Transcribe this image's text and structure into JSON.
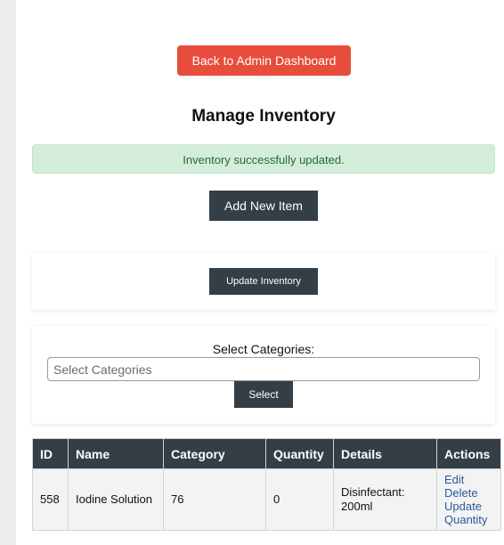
{
  "header": {
    "back_label": "Back to Admin Dashboard",
    "title": "Manage Inventory"
  },
  "alert": {
    "message": "Inventory successfully updated."
  },
  "toolbar": {
    "add_label": "Add New Item",
    "update_label": "Update Inventory"
  },
  "category_filter": {
    "label": "Select Categories:",
    "placeholder": "Select Categories",
    "button_label": "Select"
  },
  "table": {
    "headers": [
      "ID",
      "Name",
      "Category",
      "Quantity",
      "Details",
      "Actions"
    ],
    "rows": [
      {
        "id": "558",
        "name": "Iodine Solution",
        "category": "76",
        "quantity": "0",
        "details": "Disinfectant: 200ml",
        "actions": [
          "Edit",
          "Delete",
          "Update Quantity"
        ]
      }
    ]
  },
  "colors": {
    "danger": "#e74c3c",
    "dark": "#343e47",
    "success_bg": "#d4edda",
    "success_text": "#256a33"
  }
}
